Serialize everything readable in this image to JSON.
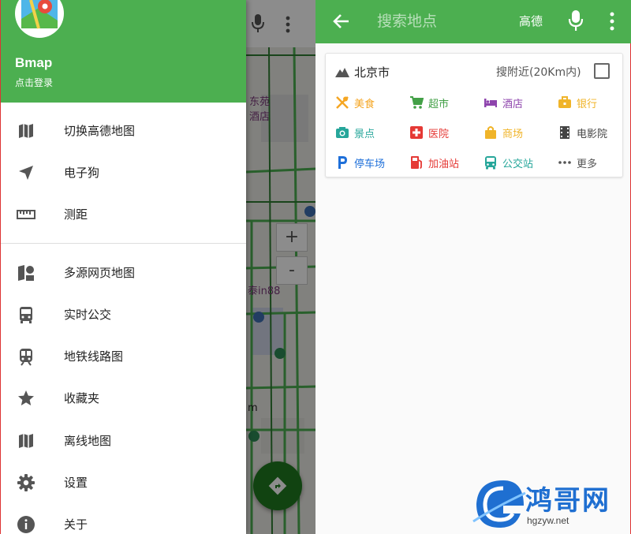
{
  "colors": {
    "primary": "#4caf50",
    "map_road": "#4caf50"
  },
  "drawer": {
    "app_name": "Bmap",
    "login_link": "点击登录",
    "items": [
      {
        "label": "切换高德地图",
        "icon": "map-icon"
      },
      {
        "label": "电子狗",
        "icon": "navigation-arrow-icon"
      },
      {
        "label": "测距",
        "icon": "ruler-icon"
      },
      {
        "label": "多源网页地图",
        "icon": "layers-icon"
      },
      {
        "label": "实时公交",
        "icon": "bus-icon"
      },
      {
        "label": "地铁线路图",
        "icon": "subway-icon"
      },
      {
        "label": "收藏夹",
        "icon": "star-icon"
      },
      {
        "label": "离线地图",
        "icon": "map-icon"
      },
      {
        "label": "设置",
        "icon": "gear-icon"
      },
      {
        "label": "关于",
        "icon": "info-icon"
      }
    ]
  },
  "map": {
    "zoom_in": "+",
    "zoom_out": "-",
    "labels": [
      "东苑",
      "酒店",
      "泰in88",
      "m"
    ]
  },
  "search": {
    "placeholder": "搜索地点",
    "provider": "高德",
    "city": "北京市",
    "nearby_label": "搜附近(20Km内)",
    "nearby_checked": false,
    "categories": [
      {
        "label": "美食",
        "icon": "utensils-icon",
        "color": "#f5a623"
      },
      {
        "label": "超市",
        "icon": "shopping-cart-icon",
        "color": "#43a047"
      },
      {
        "label": "酒店",
        "icon": "bed-icon",
        "color": "#8e44ad"
      },
      {
        "label": "银行",
        "icon": "bank-icon",
        "color": "#f0b429"
      },
      {
        "label": "景点",
        "icon": "camera-icon",
        "color": "#26a69a"
      },
      {
        "label": "医院",
        "icon": "hospital-cross-icon",
        "color": "#e53935"
      },
      {
        "label": "商场",
        "icon": "shopping-bag-icon",
        "color": "#f0b429"
      },
      {
        "label": "电影院",
        "icon": "film-icon",
        "color": "#444444"
      },
      {
        "label": "停车场",
        "icon": "parking-icon",
        "color": "#1e6fd9"
      },
      {
        "label": "加油站",
        "icon": "gas-station-icon",
        "color": "#e53935"
      },
      {
        "label": "公交站",
        "icon": "bus-icon",
        "color": "#26a69a"
      },
      {
        "label": "更多",
        "icon": "more-dots-icon",
        "color": "#555555"
      }
    ]
  },
  "watermark": {
    "brand": "鸿哥网",
    "url": "hgzyw.net"
  }
}
